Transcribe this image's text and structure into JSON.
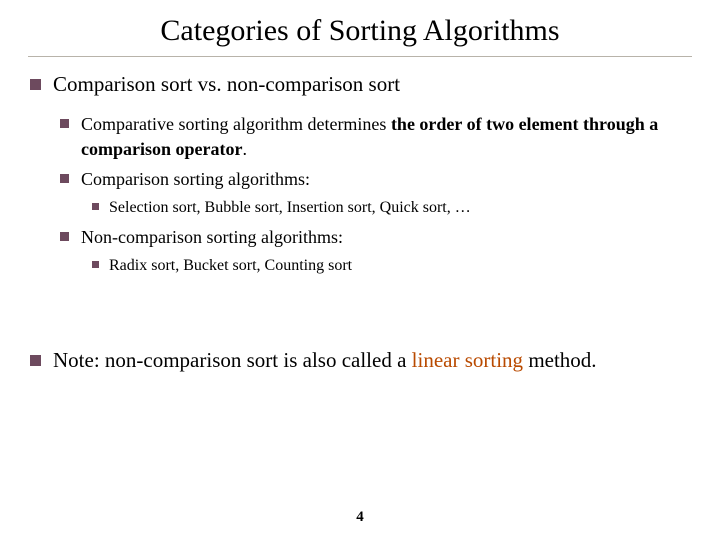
{
  "title": "Categories of Sorting Algorithms",
  "b1": "Comparison sort vs. non-comparison sort",
  "s1a_pre": "Comparative sorting algorithm determines ",
  "s1a_bold": "the order of two element through a comparison operator",
  "s1a_post": ".",
  "s1b": "Comparison sorting algorithms:",
  "s1b1": "Selection sort, Bubble sort, Insertion sort, Quick sort, …",
  "s1c": "Non-comparison sorting algorithms:",
  "s1c1": "Radix sort, Bucket sort, Counting sort",
  "note_pre": "Note: non-comparison sort is also called a ",
  "note_accent": "linear sorting",
  "note_post": " method.",
  "page": "4"
}
